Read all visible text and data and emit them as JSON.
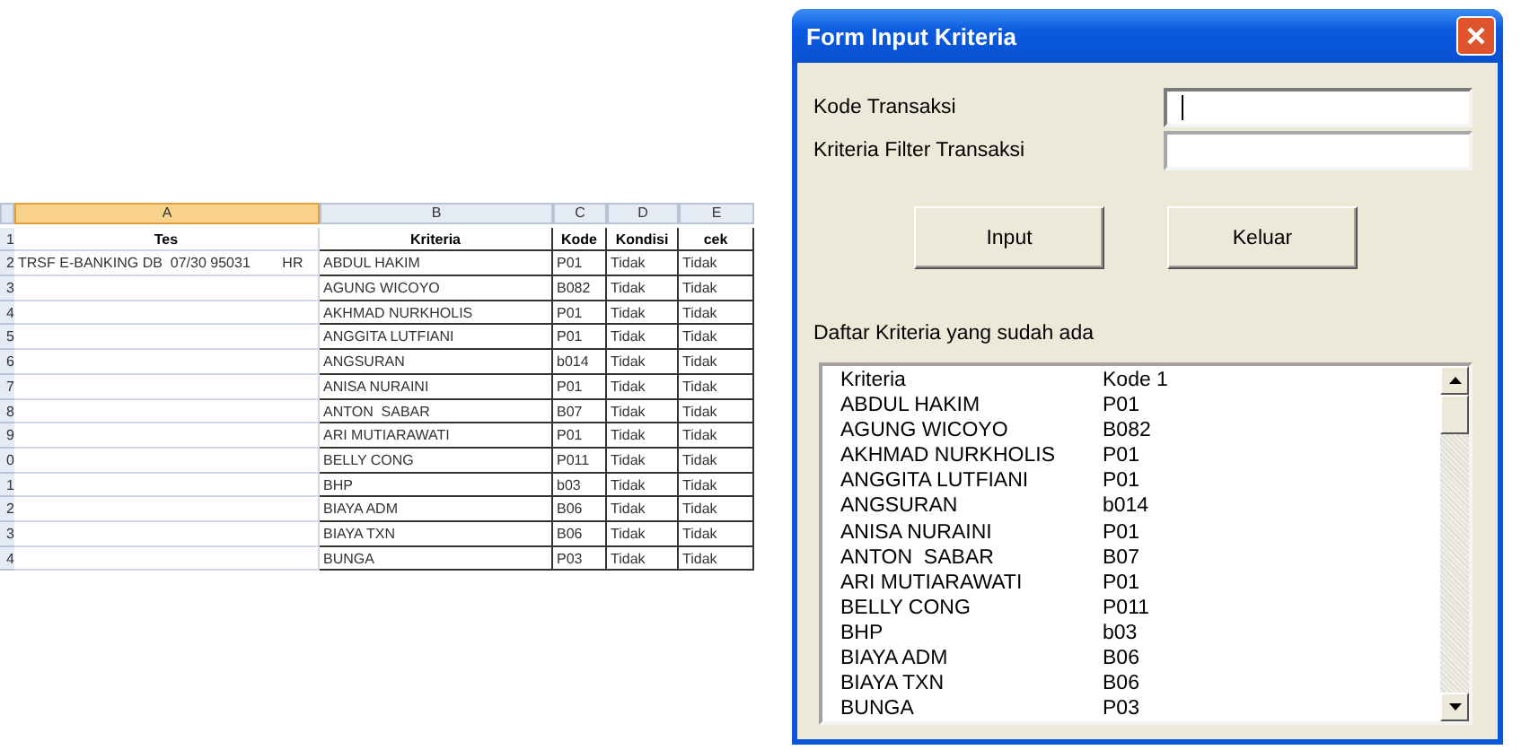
{
  "spreadsheet": {
    "columns": [
      {
        "label": "A",
        "selected": true
      },
      {
        "label": "B",
        "selected": false
      },
      {
        "label": "C",
        "selected": false
      },
      {
        "label": "D",
        "selected": false
      },
      {
        "label": "E",
        "selected": false
      }
    ],
    "rows": [
      {
        "number": "1",
        "cells": [
          "Tes",
          "Kriteria",
          "Kode",
          "Kondisi",
          "cek"
        ]
      },
      {
        "number": "2",
        "cells": [
          "TRSF E-BANKING DB  07/30 95031        HR",
          "ABDUL HAKIM",
          "P01",
          "Tidak",
          "Tidak"
        ]
      },
      {
        "number": "3",
        "cells": [
          "",
          "AGUNG WICOYO",
          "B082",
          "Tidak",
          "Tidak"
        ]
      },
      {
        "number": "4",
        "cells": [
          "",
          "AKHMAD NURKHOLIS",
          "P01",
          "Tidak",
          "Tidak"
        ]
      },
      {
        "number": "5",
        "cells": [
          "",
          "ANGGITA LUTFIANI",
          "P01",
          "Tidak",
          "Tidak"
        ]
      },
      {
        "number": "6",
        "cells": [
          "",
          "ANGSURAN",
          "b014",
          "Tidak",
          "Tidak"
        ]
      },
      {
        "number": "7",
        "cells": [
          "",
          "ANISA NURAINI",
          "P01",
          "Tidak",
          "Tidak"
        ]
      },
      {
        "number": "8",
        "cells": [
          "",
          "ANTON  SABAR",
          "B07",
          "Tidak",
          "Tidak"
        ]
      },
      {
        "number": "9",
        "cells": [
          "",
          "ARI MUTIARAWATI",
          "P01",
          "Tidak",
          "Tidak"
        ]
      },
      {
        "number": "0",
        "cells": [
          "",
          "BELLY CONG",
          "P011",
          "Tidak",
          "Tidak"
        ]
      },
      {
        "number": "1",
        "cells": [
          "",
          "BHP",
          "b03",
          "Tidak",
          "Tidak"
        ]
      },
      {
        "number": "2",
        "cells": [
          "",
          "BIAYA ADM",
          "B06",
          "Tidak",
          "Tidak"
        ]
      },
      {
        "number": "3",
        "cells": [
          "",
          "BIAYA TXN",
          "B06",
          "Tidak",
          "Tidak"
        ]
      },
      {
        "number": "4",
        "cells": [
          "",
          "BUNGA",
          "P03",
          "Tidak",
          "Tidak"
        ]
      }
    ]
  },
  "dialog": {
    "title": "Form Input Kriteria",
    "fields": [
      {
        "label": "Kode Transaksi",
        "focused": true
      },
      {
        "label": "Kriteria Filter Transaksi",
        "focused": false
      }
    ],
    "buttons": [
      "Input",
      "Keluar"
    ],
    "list_label": "Daftar Kriteria yang sudah ada",
    "list": {
      "header": [
        "Kriteria",
        "Kode 1"
      ],
      "items": [
        [
          "ABDUL HAKIM",
          "P01"
        ],
        [
          "AGUNG WICOYO",
          "B082"
        ],
        [
          "AKHMAD NURKHOLIS",
          "P01"
        ],
        [
          "ANGGITA LUTFIANI",
          "P01"
        ],
        [
          "ANGSURAN",
          "b014"
        ],
        [
          "ANISA NURAINI",
          "P01"
        ],
        [
          "ANTON  SABAR",
          "B07"
        ],
        [
          "ARI MUTIARAWATI",
          "P01"
        ],
        [
          "BELLY CONG",
          "P011"
        ],
        [
          "BHP",
          "b03"
        ],
        [
          "BIAYA ADM",
          "B06"
        ],
        [
          "BIAYA TXN",
          "B06"
        ],
        [
          "BUNGA",
          "P03"
        ]
      ]
    }
  }
}
